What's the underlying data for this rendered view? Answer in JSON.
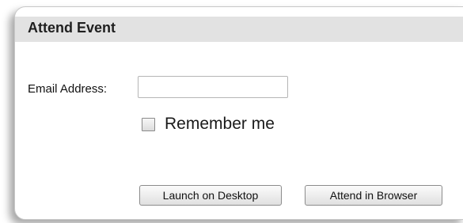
{
  "panel": {
    "title": "Attend Event"
  },
  "form": {
    "email_label": "Email Address:",
    "email_value": "",
    "email_placeholder": "",
    "remember_label": "Remember me",
    "remember_checked": false
  },
  "buttons": {
    "launch_desktop": "Launch on Desktop",
    "attend_browser": "Attend in Browser"
  }
}
